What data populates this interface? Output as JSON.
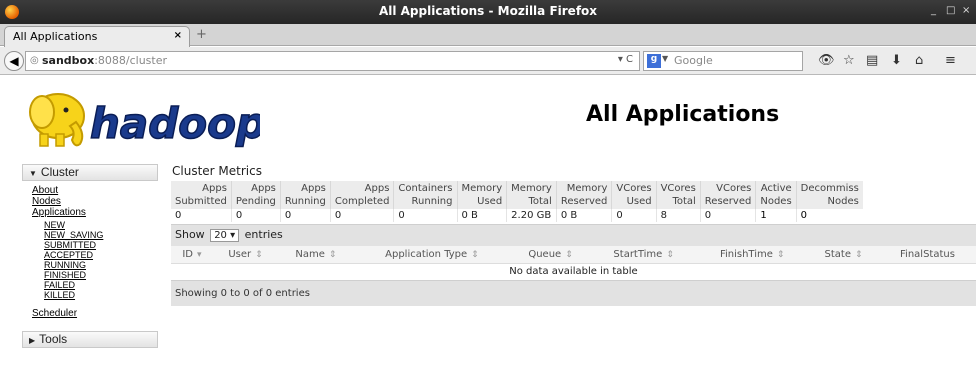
{
  "window": {
    "title": "All Applications - Mozilla Firefox",
    "controls": [
      "_",
      "□",
      "×"
    ]
  },
  "tab": {
    "label": "All Applications",
    "close": "×",
    "new_tab": "+"
  },
  "url": {
    "host": "sandbox",
    "rest": ":8088/cluster",
    "dropdown": "▾ C"
  },
  "search": {
    "engine_glyph": "g",
    "placeholder": "Google"
  },
  "toolbar_icons": [
    "binoculars-icon",
    "bookmark-star-icon",
    "library-icon",
    "download-icon",
    "home-icon",
    "menu-icon"
  ],
  "page": {
    "logo_text": "hadoop",
    "title": "All Applications"
  },
  "sidebar": {
    "cluster_label": "Cluster",
    "links": [
      "About",
      "Nodes",
      "Applications"
    ],
    "app_states": [
      "NEW",
      "NEW_SAVING",
      "SUBMITTED",
      "ACCEPTED",
      "RUNNING",
      "FINISHED",
      "FAILED",
      "KILLED"
    ],
    "scheduler": "Scheduler",
    "tools_label": "Tools"
  },
  "metrics": {
    "title": "Cluster Metrics",
    "headers": [
      [
        "Apps",
        "Submitted"
      ],
      [
        "Apps",
        "Pending"
      ],
      [
        "Apps",
        "Running"
      ],
      [
        "Apps",
        "Completed"
      ],
      [
        "Containers",
        "Running"
      ],
      [
        "Memory",
        "Used"
      ],
      [
        "Memory",
        "Total"
      ],
      [
        "Memory",
        "Reserved"
      ],
      [
        "VCores",
        "Used"
      ],
      [
        "VCores",
        "Total"
      ],
      [
        "VCores",
        "Reserved"
      ],
      [
        "Active",
        "Nodes"
      ],
      [
        "Decommiss",
        "Nodes"
      ]
    ],
    "values": [
      "0",
      "0",
      "0",
      "0",
      "0",
      "0 B",
      "2.20 GB",
      "0 B",
      "0",
      "8",
      "0",
      "1",
      "0"
    ]
  },
  "apps": {
    "show_label": "Show",
    "page_size": "20",
    "entries_label": "entries",
    "columns": [
      "ID",
      "User",
      "Name",
      "Application Type",
      "Queue",
      "StartTime",
      "FinishTime",
      "State",
      "FinalStatus"
    ],
    "empty": "No data available in table",
    "footer": "Showing 0 to 0 of 0 entries"
  }
}
